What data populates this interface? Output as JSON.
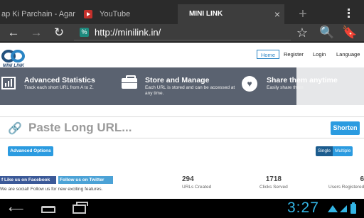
{
  "tabs": [
    {
      "title": "ap Ki Parchain - Agar ..."
    },
    {
      "title": "YouTube"
    },
    {
      "title": "MINI LINK",
      "close": "×"
    }
  ],
  "new_tab_symbol": "+",
  "toolbar": {
    "back_symbol": "←",
    "forward_symbol": "→",
    "reload_symbol": "↻",
    "url": "http://minilink.in/",
    "star_symbol": "☆",
    "search_symbol": "🔍",
    "bookmarks_symbol": "🔖"
  },
  "logo": {
    "text": "MINI LINK"
  },
  "nav": {
    "home": "Home",
    "register": "Register",
    "login": "Login",
    "language": "Language"
  },
  "features": [
    {
      "title": "Advanced Statistics",
      "description": "Track each short URL from A to Z.",
      "icon": "bar-chart-icon"
    },
    {
      "title": "Store and Manage",
      "description": "Each URL is stored and can be accessed at any time.",
      "icon": "briefcase-icon"
    },
    {
      "title": "Share them anytime",
      "description": "Easily share them",
      "icon": "heart-icon"
    }
  ],
  "shorten": {
    "placeholder": "Paste Long URL...",
    "button": "Shorten",
    "link_symbol": "🔗"
  },
  "advanced_options": "Advanced Options",
  "mode": {
    "single": "Single",
    "multiple": "Multiple"
  },
  "social": {
    "facebook": "f Like us on Facebook",
    "twitter": "Follow us on Twitter",
    "text": "We are social! Follow us for new exciting features."
  },
  "stats": [
    {
      "value": "294",
      "label": "URLs Created"
    },
    {
      "value": "1718",
      "label": "Clicks Served"
    },
    {
      "value": "6",
      "label": "Users Registered"
    }
  ],
  "system": {
    "time": "3:27",
    "back_symbol": "⟵"
  },
  "colors": {
    "accent": "#2b9be0",
    "feature_bg": "#5a6270",
    "clock": "#33b5e5"
  }
}
